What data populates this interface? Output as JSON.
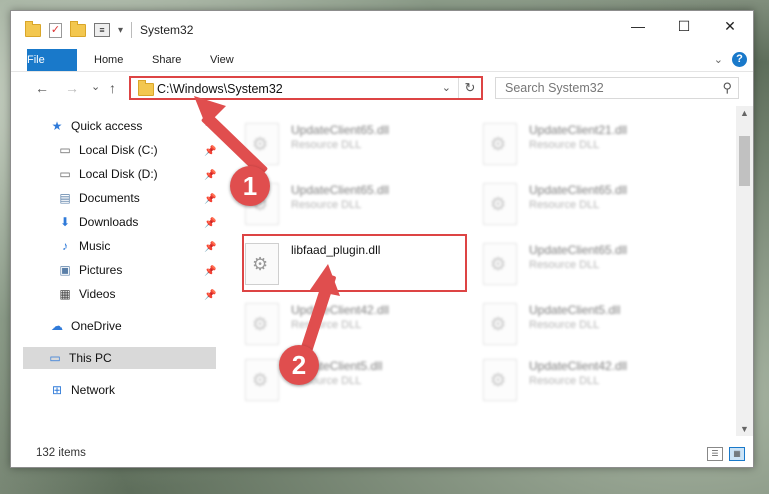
{
  "window": {
    "title": "System32",
    "controls": {
      "minimize": "—",
      "maximize": "☐",
      "close": "✕"
    }
  },
  "ribbon": {
    "tabs": [
      "File",
      "Home",
      "Share",
      "View"
    ],
    "help": "?"
  },
  "navbar": {
    "back": "←",
    "forward": "→",
    "recent": "⌄",
    "up": "↑",
    "address": "C:\\Windows\\System32",
    "search_placeholder": "Search System32"
  },
  "sidebar": {
    "items": [
      {
        "label": "Quick access",
        "icon": "star-icon",
        "pinned": false
      },
      {
        "label": "Local Disk (C:)",
        "icon": "drive-icon",
        "pinned": true
      },
      {
        "label": "Local Disk (D:)",
        "icon": "drive-icon",
        "pinned": true
      },
      {
        "label": "Documents",
        "icon": "documents-icon",
        "pinned": true
      },
      {
        "label": "Downloads",
        "icon": "downloads-icon",
        "pinned": true
      },
      {
        "label": "Music",
        "icon": "music-icon",
        "pinned": true
      },
      {
        "label": "Pictures",
        "icon": "pictures-icon",
        "pinned": true
      },
      {
        "label": "Videos",
        "icon": "videos-icon",
        "pinned": true
      },
      {
        "label": "OneDrive",
        "icon": "cloud-icon",
        "pinned": false
      },
      {
        "label": "This PC",
        "icon": "computer-icon",
        "pinned": false,
        "selected": true
      },
      {
        "label": "Network",
        "icon": "network-icon",
        "pinned": false
      }
    ]
  },
  "files": {
    "col1": [
      {
        "name": "UpdateClient65.dll",
        "type": "Resource DLL"
      },
      {
        "name": "UpdateClient65.dll",
        "type": "Resource DLL"
      },
      {
        "name": "libfaad_plugin.dll",
        "type": ""
      },
      {
        "name": "UpdateClient42.dll",
        "type": "Resource DLL"
      },
      {
        "name": "UpdateClient5.dll",
        "type": "Resource DLL"
      }
    ],
    "col2": [
      {
        "name": "UpdateClient21.dll",
        "type": "Resource DLL"
      },
      {
        "name": "UpdateClient65.dll",
        "type": "Resource DLL"
      },
      {
        "name": "UpdateClient65.dll",
        "type": "Resource DLL"
      },
      {
        "name": "UpdateClient5.dll",
        "type": "Resource DLL"
      },
      {
        "name": "UpdateClient42.dll",
        "type": "Resource DLL"
      }
    ]
  },
  "status": {
    "item_count": "132 items"
  },
  "callouts": {
    "one": "1",
    "two": "2",
    "color": "#e04e4e"
  }
}
